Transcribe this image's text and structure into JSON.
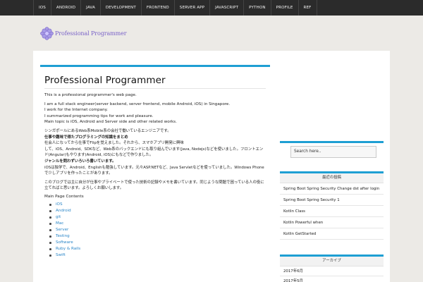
{
  "nav": {
    "items": [
      "IOS",
      "ANDROID",
      "JAVA",
      "DEVELOPMENT",
      "FRONTEND",
      "SERVER APP",
      "JAVASCRIPT",
      "PYTHON",
      "PROFILE",
      "REF"
    ]
  },
  "logo": {
    "text": "Professional Programmer"
  },
  "article": {
    "title": "Professional Programmer",
    "intro": "This is a professional programmer's web page.",
    "en_lines": [
      "I am a full stack engineer(server backend, server frontend, mobile Android, iOS) in Singapore.",
      "I work for the Internet company.",
      "I summarized programming tips for work and pleasure.",
      "Main topic is iOS, Android and Server side and other related works."
    ],
    "ja_lines": [
      "シンガポールにあるWeb系Mobile系の会社で働いているエンジニアです。",
      "仕事や趣味で得たプログラミングの知識をまとめ",
      "社会人になってから仕事でFlipを覚えました。それから、スマホアプリ開発に興味",
      "して、iOS、Android、SDKなど、Web系のバックエンドにも取り組んでいます(Java, Nodejs)などを使いました。フロントエンド(Angular)もやります(Android, iOS)にもなどで作りました。",
      "ジャンルを問わずいろいろ書いています。",
      "iOSは独学で、Android、Englishも勉強しています。元々ASP.NETなど、Java Servletなどを使っていました。Windows Phoneで少しアプリを作ったことがあります。"
    ],
    "ja_para": "このブログでは主に自分が仕事やプライベートで使った技術の記録やメモを書いています。同じような問題で困っている人の役に立てればと思います。よろしくお願いします。",
    "contents_title": "Main Page Contents",
    "contents": [
      "iOS",
      "Android",
      "git",
      "Mac",
      "Server",
      "Testing",
      "Software",
      "Ruby & Rails",
      "Swift"
    ]
  },
  "sidebar": {
    "search_placeholder": "Search here..",
    "recent_title": "最近の投稿",
    "recent_posts": [
      "Spring Boot Spring Security Change dst after login",
      "Spring Boot Spring Security 1",
      "Kotlin Class",
      "Kotlin Powerful when",
      "Kotlin GetStarted"
    ],
    "archive_title": "アーカイブ",
    "archives": [
      "2017年6月",
      "2017年5月"
    ]
  },
  "colors": {
    "accent": "#1e9fd3",
    "nav_bg": "#2b2b2b",
    "logo": "#7a63c8",
    "link": "#2a86c8"
  }
}
